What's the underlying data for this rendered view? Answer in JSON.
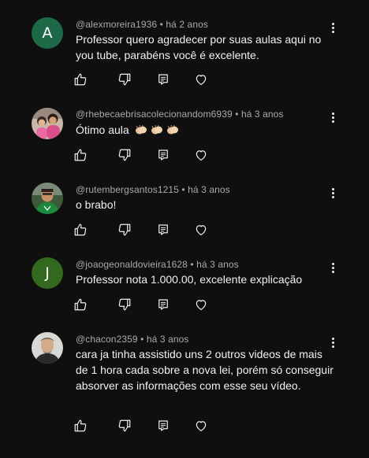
{
  "comments": [
    {
      "username": "@alexmoreira1936",
      "time": "há 2 anos",
      "text": "Professor quero agradecer por suas aulas aqui no you tube, parabéns você é excelente.",
      "avatar_letter": "A",
      "avatar_color": "#1e6a48"
    },
    {
      "username": "@rhebecaebrisacolecionandom6939",
      "time": "há 3 anos",
      "text": "Ótimo aula",
      "emoji": [
        "clapping-hands",
        "clapping-hands",
        "clapping-hands"
      ]
    },
    {
      "username": "@rutembergsantos1215",
      "time": "há 3 anos",
      "text": "o brabo!"
    },
    {
      "username": "@joaogeonaldovieira1628",
      "time": "há 3 anos",
      "text": "Professor nota 1.000.00, excelente explicação",
      "avatar_letter": "J",
      "avatar_color": "#33691e"
    },
    {
      "username": "@chacon2359",
      "time": "há 3 anos",
      "text": "cara ja tinha assistido uns 2 outros videos de mais de 1 hora cada sobre a nova lei, porém só conseguir absorver as informações com esse  seu vídeo."
    }
  ],
  "separator": "•",
  "icons": {
    "like": "thumbs-up-icon",
    "dislike": "thumbs-down-icon",
    "reply": "reply-icon",
    "heart": "heart-icon",
    "more": "more-vert-icon"
  }
}
